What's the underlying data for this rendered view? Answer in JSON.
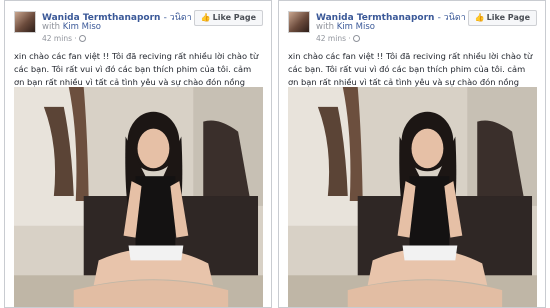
{
  "posts": [
    {
      "author": "Wanida Termthanaporn",
      "author_thai": "- วนิดา เติมธนาภรณ์",
      "with_label": "with",
      "tagged": "Kim Miso",
      "time": "42 mins ·",
      "like_button": "Like Page",
      "text": "xin chào các fan việt !! Tôi đã reciving rất nhiều lời chào từ các bạn. Tôi rất vui vì đó các bạn thích phim của tôi. cảm ơn bạn rất nhiều vì tất cả tình yêu và sự chào đón nồng nhiệt từ Việt Nam. yêu",
      "emoji": "😘💟💟"
    },
    {
      "author": "Wanida Termthanaporn",
      "author_thai": "- วนิดา เติมธนาภรณ์",
      "with_label": "with",
      "tagged": "Kim Miso",
      "time": "42 mins ·",
      "like_button": "Like Page",
      "text": "xin chào các fan việt !! Tôi đã reciving rất nhiều lời chào từ các bạn. Tôi rất vui vì đó các bạn thích phim của tôi. cảm ơn bạn rất nhiều vì tất cả tình yêu và sự chào đón nồng nhiệt từ Việt Nam. yêu",
      "emoji": "😘💟💟"
    }
  ],
  "icons": {
    "like": "thumbs-up-icon",
    "privacy": "globe-icon"
  },
  "colors": {
    "link": "#3b5998",
    "meta": "#90949c",
    "border": "#c9ccd1"
  }
}
